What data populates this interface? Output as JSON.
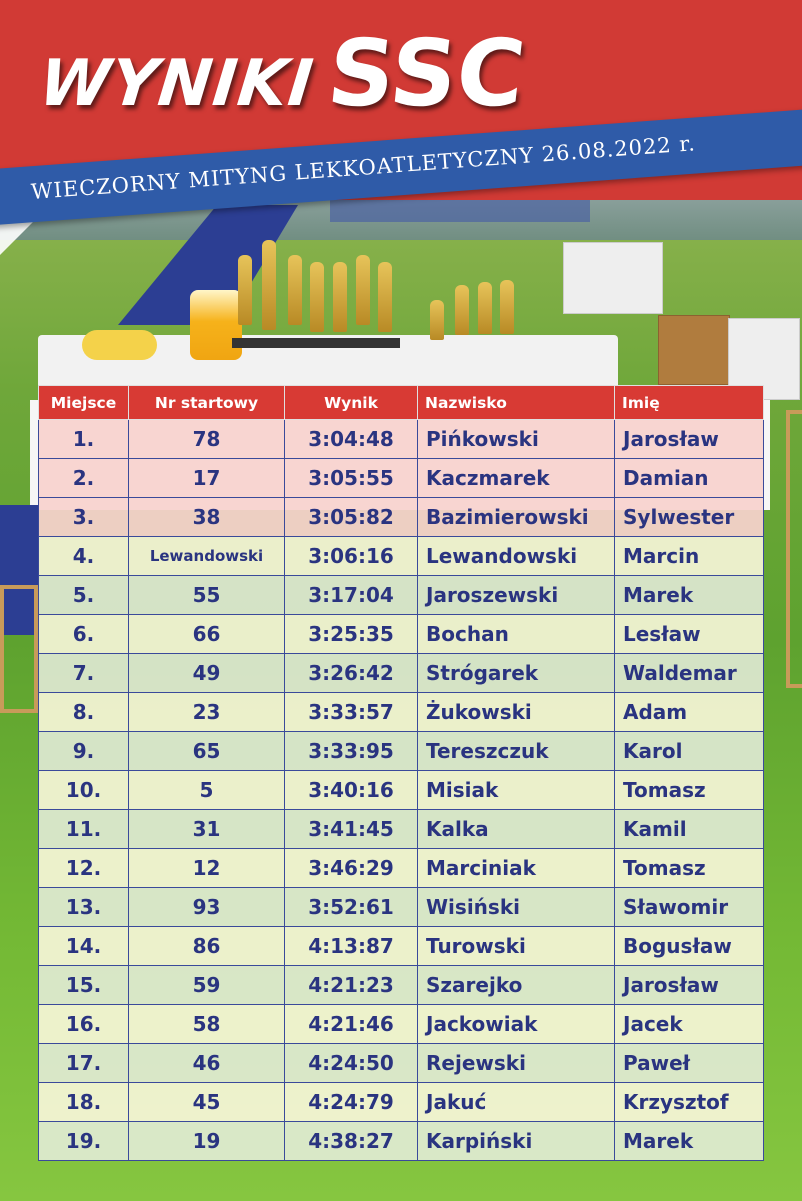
{
  "header": {
    "title_part1": "WYNIKI",
    "title_part2": "SSC",
    "subtitle": "WIECZORNY MITYNG LEKKOATLETYCZNY 26.08.2022 r."
  },
  "colors": {
    "header_red": "#d13a35",
    "ribbon_blue": "#2f5ba8",
    "table_header": "#d83a34",
    "text_navy": "#2a3480"
  },
  "table": {
    "headers": [
      "Miejsce",
      "Nr startowy",
      "Wynik",
      "Nazwisko",
      "Imię"
    ],
    "rows": [
      {
        "place": "1.",
        "bib": "78",
        "time": "3:04:48",
        "surname": "Pińkowski",
        "name": "Jarosław"
      },
      {
        "place": "2.",
        "bib": "17",
        "time": "3:05:55",
        "surname": "Kaczmarek",
        "name": "Damian"
      },
      {
        "place": "3.",
        "bib": "38",
        "time": "3:05:82",
        "surname": "Bazimierowski",
        "name": "Sylwester"
      },
      {
        "place": "4.",
        "bib": "Lewandowski",
        "time": "3:06:16",
        "surname": "Lewandowski",
        "name": "Marcin"
      },
      {
        "place": "5.",
        "bib": "55",
        "time": "3:17:04",
        "surname": "Jaroszewski",
        "name": "Marek"
      },
      {
        "place": "6.",
        "bib": "66",
        "time": "3:25:35",
        "surname": "Bochan",
        "name": "Lesław"
      },
      {
        "place": "7.",
        "bib": "49",
        "time": "3:26:42",
        "surname": "Strógarek",
        "name": "Waldemar"
      },
      {
        "place": "8.",
        "bib": "23",
        "time": "3:33:57",
        "surname": "Żukowski",
        "name": "Adam"
      },
      {
        "place": "9.",
        "bib": "65",
        "time": "3:33:95",
        "surname": "Tereszczuk",
        "name": "Karol"
      },
      {
        "place": "10.",
        "bib": "5",
        "time": "3:40:16",
        "surname": "Misiak",
        "name": "Tomasz"
      },
      {
        "place": "11.",
        "bib": "31",
        "time": "3:41:45",
        "surname": "Kalka",
        "name": "Kamil"
      },
      {
        "place": "12.",
        "bib": "12",
        "time": "3:46:29",
        "surname": "Marciniak",
        "name": "Tomasz"
      },
      {
        "place": "13.",
        "bib": "93",
        "time": "3:52:61",
        "surname": "Wisiński",
        "name": "Sławomir"
      },
      {
        "place": "14.",
        "bib": "86",
        "time": "4:13:87",
        "surname": "Turowski",
        "name": "Bogusław"
      },
      {
        "place": "15.",
        "bib": "59",
        "time": "4:21:23",
        "surname": "Szarejko",
        "name": "Jarosław"
      },
      {
        "place": "16.",
        "bib": "58",
        "time": "4:21:46",
        "surname": "Jackowiak",
        "name": "Jacek"
      },
      {
        "place": "17.",
        "bib": "46",
        "time": "4:24:50",
        "surname": "Rejewski",
        "name": "Paweł"
      },
      {
        "place": "18.",
        "bib": "45",
        "time": "4:24:79",
        "surname": "Jakuć",
        "name": "Krzysztof"
      },
      {
        "place": "19.",
        "bib": "19",
        "time": "4:38:27",
        "surname": "Karpiński",
        "name": "Marek"
      }
    ]
  }
}
